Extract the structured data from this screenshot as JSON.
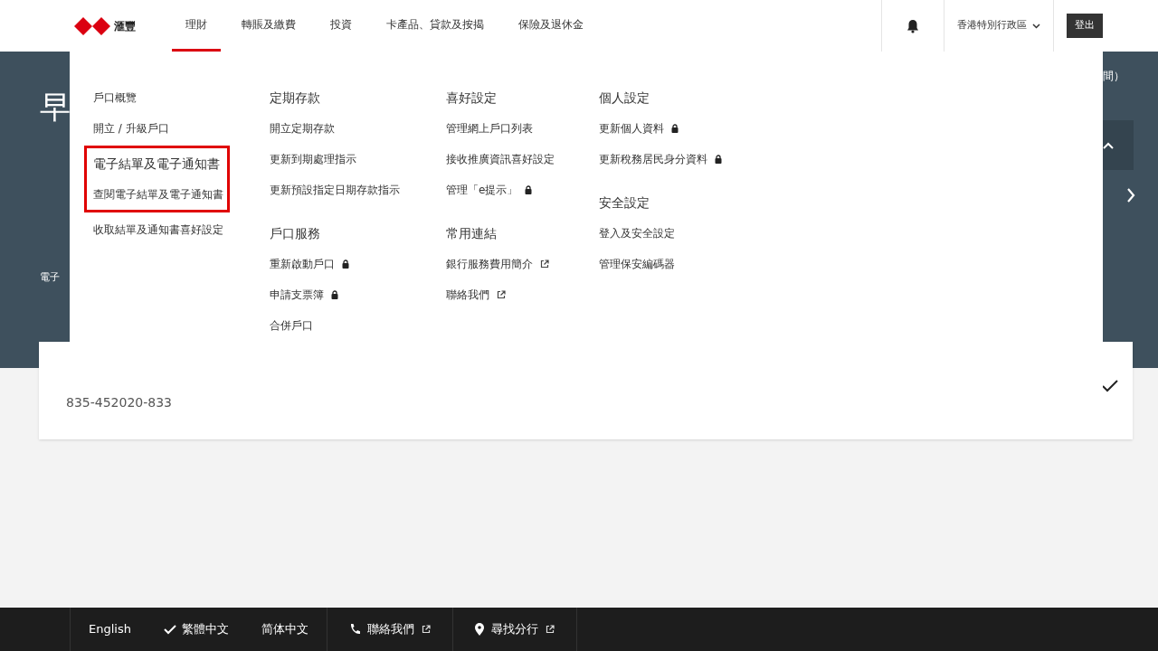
{
  "header": {
    "logo_text": "滙豐",
    "nav": [
      {
        "label": "理財",
        "selected": true
      },
      {
        "label": "轉賬及繳費",
        "selected": false
      },
      {
        "label": "投資",
        "selected": false
      },
      {
        "label": "卡產品、貸款及按揭",
        "selected": false
      },
      {
        "label": "保險及退休金",
        "selected": false
      }
    ],
    "region": "香港特別行政區",
    "logout": "登出"
  },
  "background": {
    "greeting": "早",
    "side_text": "電子",
    "corner_text": "間）",
    "account_number": "835-452020-833"
  },
  "menu": {
    "columns": [
      {
        "groups": [
          {
            "items": [
              {
                "label": "戶口概覽",
                "kind": "plain"
              },
              {
                "label": "開立 / 升級戶口",
                "kind": "plain"
              }
            ]
          },
          {
            "heading": "電子結單及電子通知書",
            "highlighted": true,
            "items": [
              {
                "label": "查閱電子結單及電子通知書",
                "kind": "plain"
              }
            ]
          },
          {
            "items": [
              {
                "label": "收取結單及通知書喜好設定",
                "kind": "plain"
              }
            ]
          }
        ]
      },
      {
        "groups": [
          {
            "heading": "定期存款",
            "highlighted": false,
            "items": [
              {
                "label": "開立定期存款",
                "kind": "plain"
              },
              {
                "label": "更新到期處理指示",
                "kind": "plain"
              },
              {
                "label": "更新預設指定日期存款指示",
                "kind": "plain"
              }
            ]
          },
          {
            "heading": "戶口服務",
            "highlighted": false,
            "items": [
              {
                "label": "重新啟動戶口",
                "kind": "lock"
              },
              {
                "label": "申請支票簿",
                "kind": "lock"
              },
              {
                "label": "合併戶口",
                "kind": "plain"
              }
            ]
          }
        ]
      },
      {
        "groups": [
          {
            "heading": "喜好設定",
            "highlighted": false,
            "items": [
              {
                "label": "管理網上戶口列表",
                "kind": "plain"
              },
              {
                "label": "接收推廣資訊喜好設定",
                "kind": "plain"
              },
              {
                "label": "管理「e提示」",
                "kind": "lock"
              }
            ]
          },
          {
            "heading": "常用連結",
            "highlighted": false,
            "items": [
              {
                "label": "銀行服務費用簡介",
                "kind": "external"
              },
              {
                "label": "聯絡我們",
                "kind": "external"
              }
            ]
          }
        ]
      },
      {
        "groups": [
          {
            "heading": "個人設定",
            "highlighted": false,
            "items": [
              {
                "label": "更新個人資料",
                "kind": "lock"
              },
              {
                "label": "更新稅務居民身分資料",
                "kind": "lock"
              }
            ]
          },
          {
            "heading": "安全設定",
            "highlighted": false,
            "items": [
              {
                "label": "登入及安全設定",
                "kind": "plain"
              },
              {
                "label": "管理保安編碼器",
                "kind": "plain"
              }
            ]
          }
        ]
      }
    ]
  },
  "footer": {
    "languages": [
      {
        "label": "English",
        "selected": false
      },
      {
        "label": "繁體中文",
        "selected": true
      },
      {
        "label": "简体中文",
        "selected": false
      }
    ],
    "links": [
      {
        "label": "聯絡我們",
        "kind": "phone"
      },
      {
        "label": "尋找分行",
        "kind": "pin"
      }
    ]
  }
}
